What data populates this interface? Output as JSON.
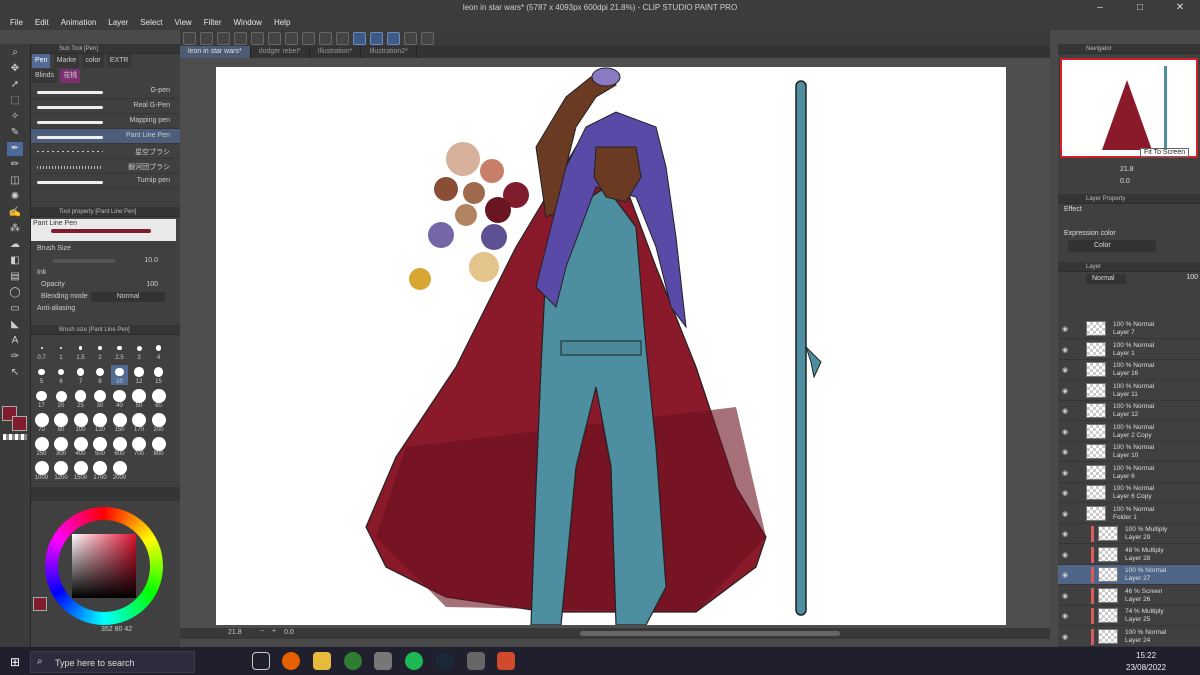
{
  "window": {
    "title": "leon in star wars* (5787 x 4093px 600dpi 21.8%) - CLIP STUDIO PAINT PRO"
  },
  "menu": [
    "File",
    "Edit",
    "Animation",
    "Layer",
    "Select",
    "View",
    "Filter",
    "Window",
    "Help"
  ],
  "tabs": [
    "leon in star wars*",
    "dodger rebel*",
    "Illustration*",
    "Illustration2*"
  ],
  "subtool": {
    "header": "Sub Tool [Pen]",
    "tabs": [
      "Pen",
      "Marke",
      "color",
      "EXTR"
    ],
    "tabs2": [
      "Blinds",
      "花桃"
    ],
    "brushes": [
      "G-pen",
      "Real G-Pen",
      "Mapping pen",
      "Pant Line Pen",
      "星空ブラシ",
      "銀河団ブラシ",
      "Turnip pen"
    ]
  },
  "toolprop": {
    "header": "Tool property [Pant Line Pen]",
    "preview_label": "Pant Line Pen",
    "brush_size_label": "Brush Size",
    "brush_size_value": "10.0",
    "ink_label": "Ink",
    "opacity_label": "Opacity",
    "opacity_value": "100",
    "blending_label": "Blending mode",
    "blending_value": "Normal",
    "antialias_label": "Anti-aliasing"
  },
  "brushsize": {
    "header": "Brush size [Pant Line Pen]",
    "sizes": [
      "0.7",
      "1",
      "1.5",
      "2",
      "2.5",
      "3",
      "4",
      "5",
      "6",
      "7",
      "8",
      "10",
      "12",
      "15",
      "17",
      "20",
      "25",
      "30",
      "40",
      "50",
      "60",
      "70",
      "80",
      "100",
      "120",
      "150",
      "170",
      "200",
      "250",
      "300",
      "400",
      "500",
      "600",
      "700",
      "800",
      "1000",
      "1200",
      "1500",
      "1700",
      "2000"
    ]
  },
  "colorwheel": {
    "readout": "352  80  42",
    "main_color": "#7f1d2e",
    "sub_color": "#ffffff"
  },
  "navigator": {
    "header": "Navigator",
    "zoom": "21.8",
    "angle": "0.0",
    "tooltip": "Fit To Screen"
  },
  "layerprop": {
    "header": "Layer Property",
    "effect_label": "Effect",
    "expression_label": "Expression color",
    "expression_value": "Color"
  },
  "layerpanel": {
    "header": "Layer",
    "blend": "Normal",
    "opacity": "100",
    "layers": [
      {
        "l1": "100 % Normal",
        "l2": "Layer 7"
      },
      {
        "l1": "100 % Normal",
        "l2": "Layer 1"
      },
      {
        "l1": "100 % Normal",
        "l2": "Layer 16"
      },
      {
        "l1": "100 % Normal",
        "l2": "Layer 11"
      },
      {
        "l1": "100 % Normal",
        "l2": "Layer 12"
      },
      {
        "l1": "100 % Normal",
        "l2": "Layer 2 Copy"
      },
      {
        "l1": "100 % Normal",
        "l2": "Layer 10"
      },
      {
        "l1": "100 % Normal",
        "l2": "Layer 6"
      },
      {
        "l1": "100 % Normal",
        "l2": "Layer 6 Copy"
      },
      {
        "l1": "100 % Normal",
        "l2": "Folder 1"
      },
      {
        "l1": "100 % Multiply",
        "l2": "Layer 29"
      },
      {
        "l1": "48 % Multiply",
        "l2": "Layer 28"
      },
      {
        "l1": "100 % Normal",
        "l2": "Layer 27"
      },
      {
        "l1": "46 % Screen",
        "l2": "Layer 26"
      },
      {
        "l1": "74 % Multiply",
        "l2": "Layer 25"
      },
      {
        "l1": "100 % Normal",
        "l2": "Layer 24"
      }
    ]
  },
  "statusbar": {
    "zoom": "21.8",
    "angle": "0.0"
  },
  "taskbar": {
    "search": "Type here to search",
    "time": "15:22",
    "date": "23/08/2022"
  },
  "palette": {
    "swatches": [
      "#d6b09a",
      "#c97e6a",
      "#8a4e36",
      "#a06a4e",
      "#7f1d2e",
      "#6a1522",
      "#b08460",
      "#5d5194",
      "#7566a8",
      "#e3c48a",
      "#d8a632"
    ]
  },
  "artwork": {
    "cape": "#8a1a2a",
    "suit": "#4d8fa0",
    "hair": "#5a4aa8",
    "skin": "#6a3a22"
  }
}
